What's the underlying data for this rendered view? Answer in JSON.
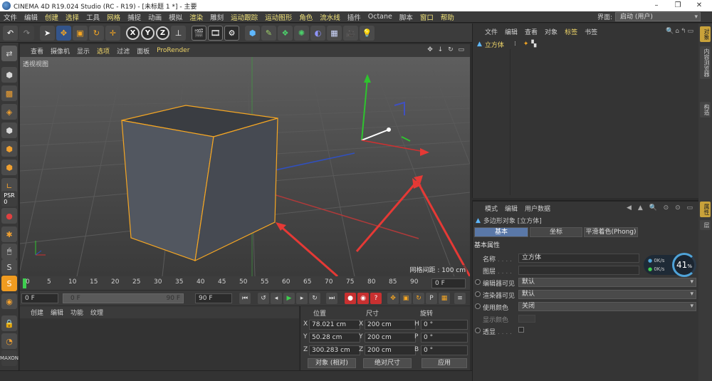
{
  "window": {
    "title": "CINEMA 4D R19.024 Studio (RC - R19) - [未标题 1 *] - 主要",
    "min": "–",
    "max": "❐",
    "close": "✕"
  },
  "menubar": {
    "items": [
      "文件",
      "编辑",
      "创建",
      "选择",
      "工具",
      "网格",
      "捕捉",
      "动画",
      "模拟",
      "渲染",
      "雕刻",
      "运动跟踪",
      "运动图形",
      "角色",
      "流水线",
      "插件",
      "Octane",
      "脚本",
      "窗口",
      "帮助"
    ],
    "interface_label": "界面:",
    "interface_value": "启动 (用户)"
  },
  "toolbar": {
    "undo": "↶",
    "axis_x": "X",
    "axis_y": "Y",
    "axis_z": "Z"
  },
  "viewport": {
    "menu": [
      "查看",
      "摄像机",
      "显示",
      "选项",
      "过滤",
      "面板",
      "ProRender"
    ],
    "label": "透视视图",
    "grid_label": "网格间距 : 100 cm"
  },
  "timeline": {
    "ticks": [
      "0",
      "5",
      "10",
      "15",
      "20",
      "25",
      "30",
      "35",
      "40",
      "45",
      "50",
      "55",
      "60",
      "65",
      "70",
      "75",
      "80",
      "85",
      "90"
    ],
    "end_field": "0 F"
  },
  "timectl": {
    "start": "0 F",
    "range_start": "0 F",
    "range_end": "90 F",
    "end": "90 F"
  },
  "material": {
    "menu": [
      "创建",
      "编辑",
      "功能",
      "纹理"
    ]
  },
  "coords": {
    "headers": {
      "pos": "位置",
      "size": "尺寸",
      "rot": "旋转"
    },
    "rows": [
      {
        "axis": "X",
        "pos": "78.021 cm",
        "saxis": "X",
        "size": "200 cm",
        "raxis": "H",
        "rot": "0 °"
      },
      {
        "axis": "Y",
        "pos": "50.28 cm",
        "saxis": "Y",
        "size": "200 cm",
        "raxis": "P",
        "rot": "0 °"
      },
      {
        "axis": "Z",
        "pos": "300.283 cm",
        "saxis": "Z",
        "size": "200 cm",
        "raxis": "B",
        "rot": "0 °"
      }
    ],
    "mode": "对象 (相对)",
    "size_mode": "绝对尺寸",
    "apply": "应用"
  },
  "objects": {
    "menu": [
      "文件",
      "编辑",
      "查看",
      "对象",
      "标签",
      "书签"
    ],
    "items": [
      {
        "name": "立方体"
      }
    ]
  },
  "attributes": {
    "menu": [
      "模式",
      "编辑",
      "用户数据"
    ],
    "object_title": "多边形对象 [立方体]",
    "tabs": [
      "基本",
      "坐标",
      "平滑着色(Phong)"
    ],
    "section": "基本属性",
    "rows": [
      {
        "label": "名称",
        "value": "立方体",
        "type": "text"
      },
      {
        "label": "图层",
        "value": "",
        "type": "text"
      },
      {
        "label": "编辑器可见",
        "value": "默认",
        "type": "dropdown"
      },
      {
        "label": "渲染器可见",
        "value": "默认",
        "type": "dropdown"
      },
      {
        "label": "使用颜色",
        "value": "关闭",
        "type": "dropdown"
      },
      {
        "label": "显示颜色",
        "value": "",
        "type": "color"
      },
      {
        "label": "透显",
        "value": "",
        "type": "check"
      }
    ]
  },
  "right_tabs": [
    "对象",
    "内容浏览器",
    "构造",
    "属性",
    "层"
  ],
  "perf": {
    "up": "0K/s",
    "down": "0K/s",
    "percent": "41",
    "unit": "%"
  },
  "colors": {
    "accent": "#f0d668",
    "selection": "#5a78a8",
    "cube_outline": "#f5a623",
    "arrow": "#e53935"
  }
}
